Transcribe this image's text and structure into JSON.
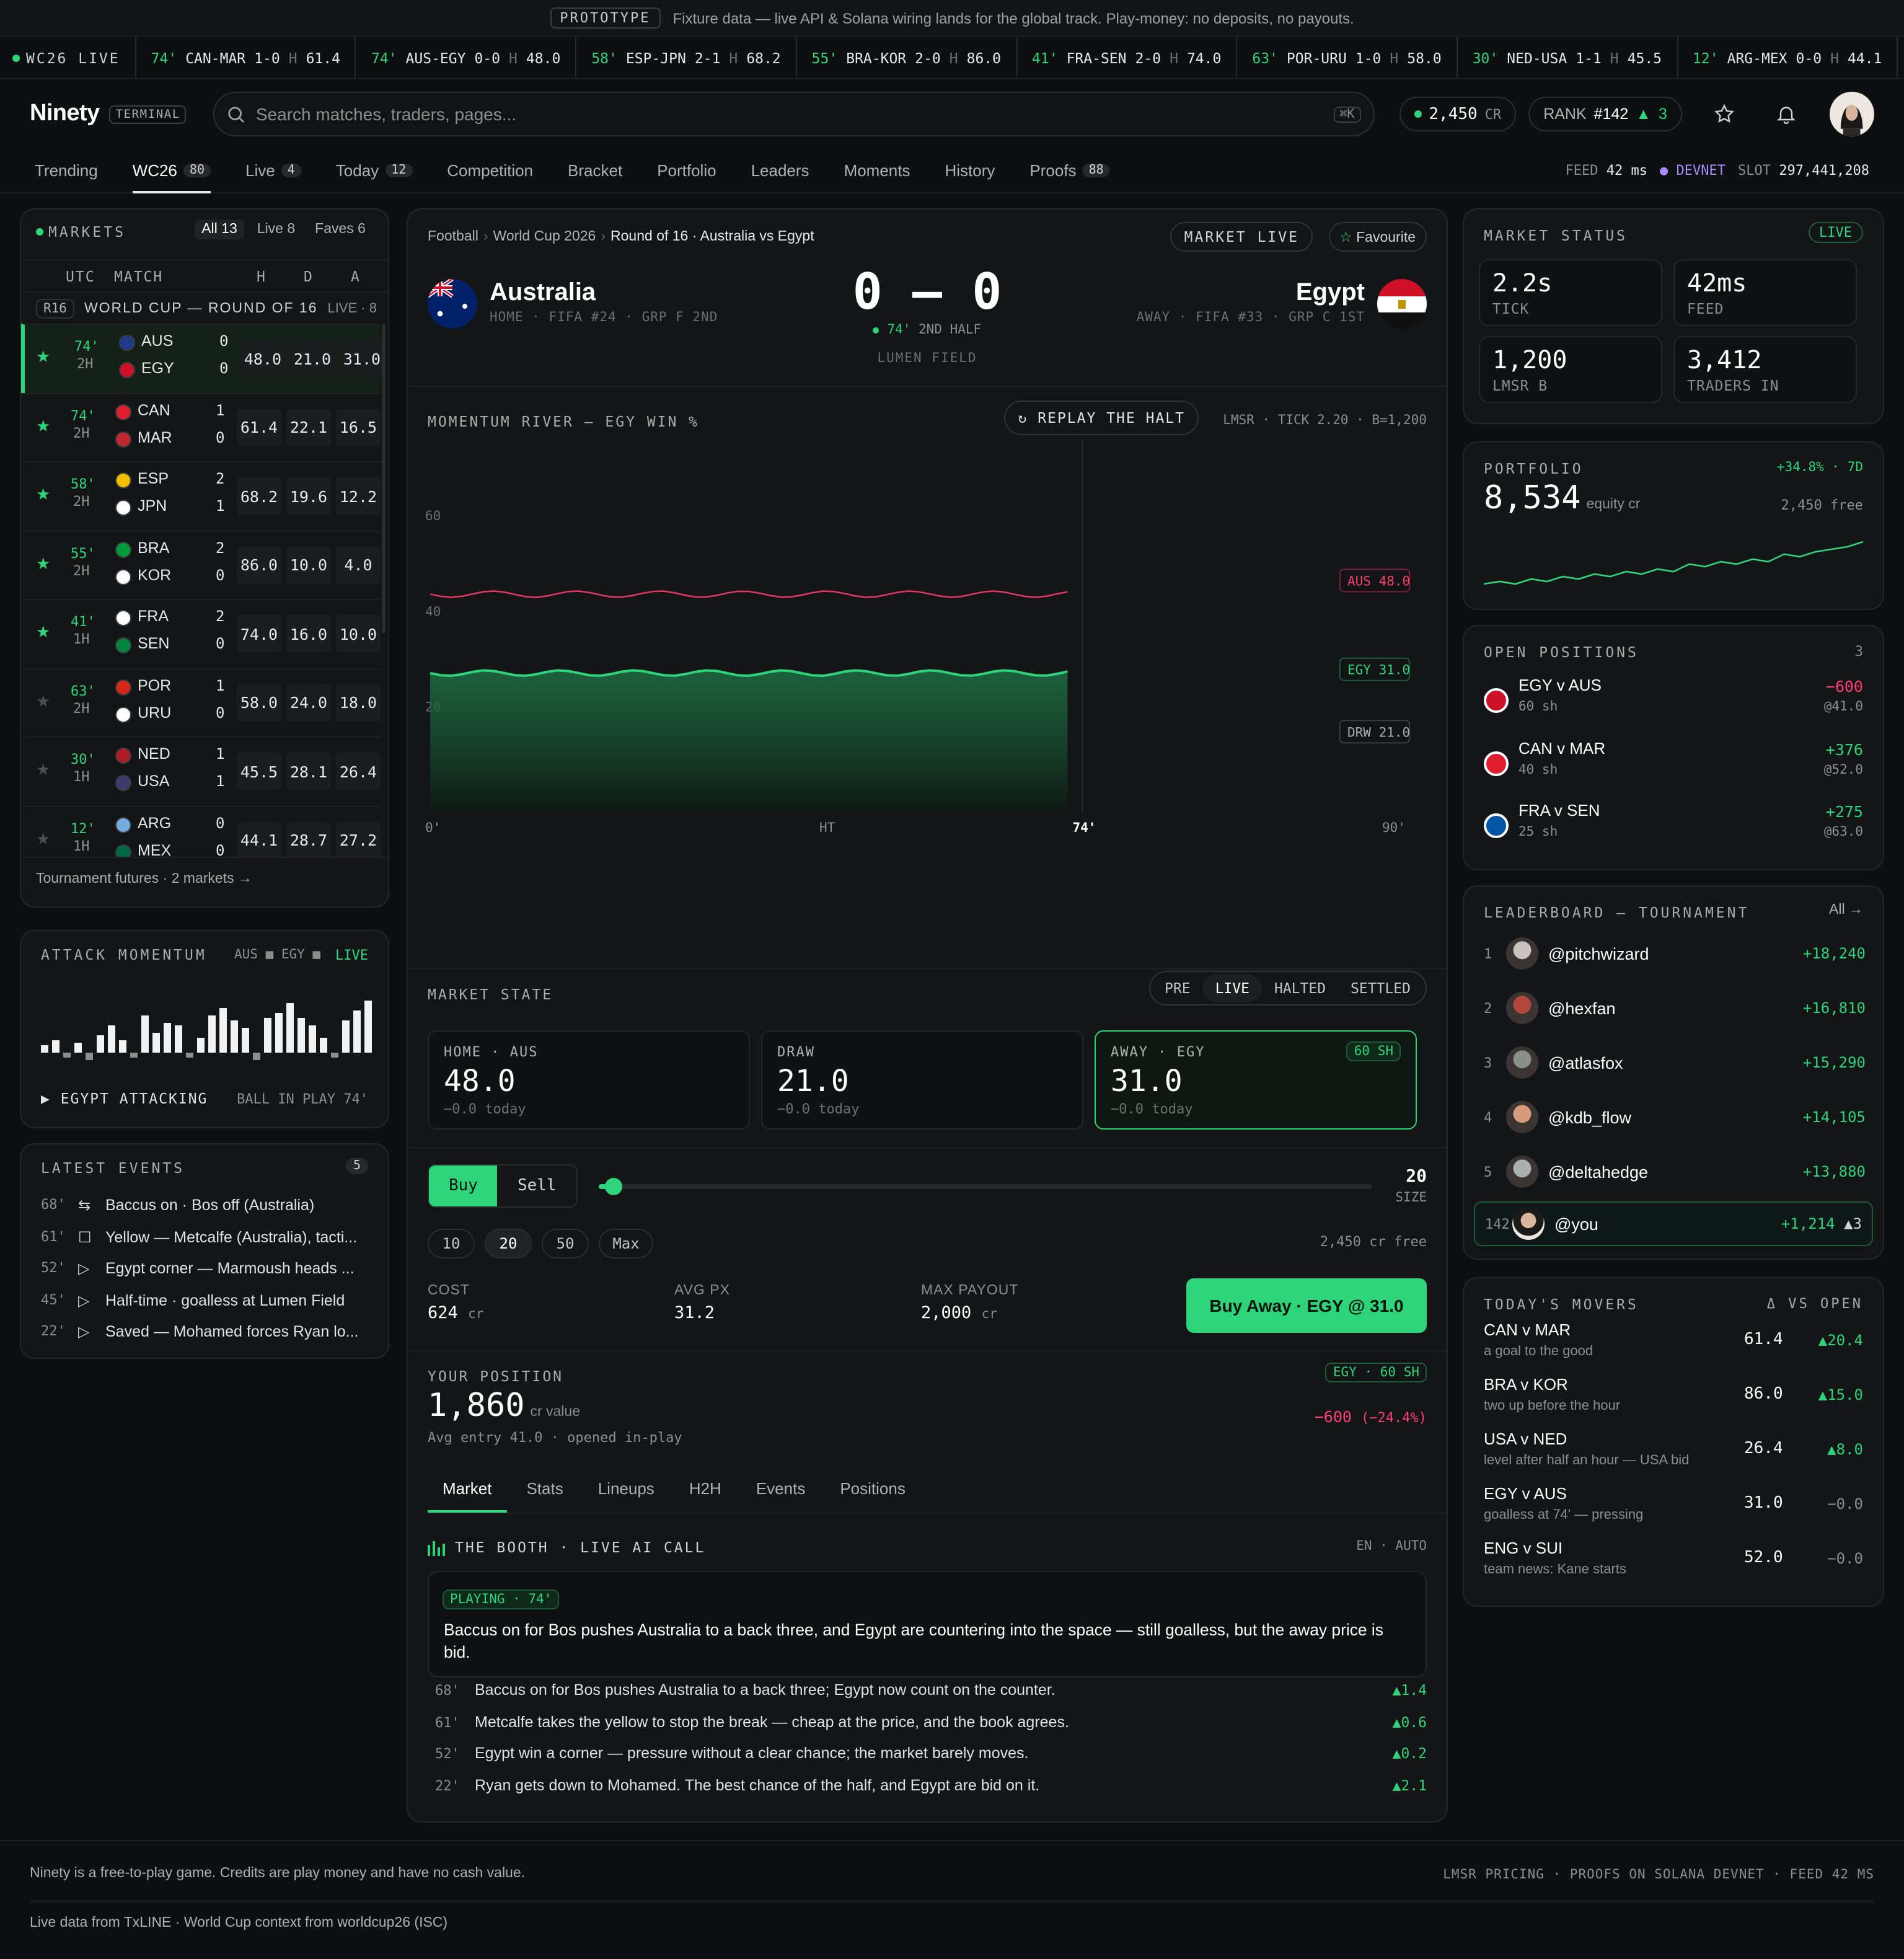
{
  "banner": {
    "tag": "PROTOTYPE",
    "text": "Fixture data — live API & Solana wiring lands for the global track. Play-money: no deposits, no payouts."
  },
  "ticker": {
    "label": "WC26 LIVE",
    "items": [
      {
        "min": "74'",
        "match": "CAN-MAR",
        "score": "1-0",
        "h": "H",
        "price": "61.4"
      },
      {
        "min": "74'",
        "match": "AUS-EGY",
        "score": "0-0",
        "h": "H",
        "price": "48.0"
      },
      {
        "min": "58'",
        "match": "ESP-JPN",
        "score": "2-1",
        "h": "H",
        "price": "68.2"
      },
      {
        "min": "55'",
        "match": "BRA-KOR",
        "score": "2-0",
        "h": "H",
        "price": "86.0"
      },
      {
        "min": "41'",
        "match": "FRA-SEN",
        "score": "2-0",
        "h": "H",
        "price": "74.0"
      },
      {
        "min": "63'",
        "match": "POR-URU",
        "score": "1-0",
        "h": "H",
        "price": "58.0"
      },
      {
        "min": "30'",
        "match": "NED-USA",
        "score": "1-1",
        "h": "H",
        "price": "45.5"
      },
      {
        "min": "12'",
        "match": "ARG-MEX",
        "score": "0-0",
        "h": "H",
        "price": "44.1"
      }
    ]
  },
  "header": {
    "logo": "Ninety",
    "terminal": "TERMINAL",
    "search_placeholder": "Search matches, traders, pages...",
    "kbd": "⌘K",
    "credits": "2,450",
    "credits_unit": "CR",
    "rank_label": "RANK",
    "rank": "#142",
    "rank_delta": "3"
  },
  "nav": {
    "tabs": [
      {
        "label": "Trending",
        "badge": ""
      },
      {
        "label": "WC26",
        "badge": "80"
      },
      {
        "label": "Live",
        "badge": "4"
      },
      {
        "label": "Today",
        "badge": "12"
      },
      {
        "label": "Competition",
        "badge": ""
      },
      {
        "label": "Bracket",
        "badge": ""
      },
      {
        "label": "Portfolio",
        "badge": ""
      },
      {
        "label": "Leaders",
        "badge": ""
      },
      {
        "label": "Moments",
        "badge": ""
      },
      {
        "label": "History",
        "badge": ""
      },
      {
        "label": "Proofs",
        "badge": "88"
      }
    ],
    "feed_label": "FEED",
    "feed": "42 ms",
    "devnet": "DEVNET",
    "slot_label": "SLOT",
    "slot": "297,441,208"
  },
  "markets": {
    "title": "MARKETS",
    "filters": [
      "All 13",
      "Live 8",
      "Faves 6"
    ],
    "cols": [
      "UTC",
      "MATCH",
      "H",
      "D",
      "A"
    ],
    "group": "R16",
    "group_title": "WORLD CUP — ROUND OF 16",
    "group_live": "LIVE · 8",
    "rows": [
      {
        "min": "74'",
        "half": "2H",
        "t1": "AUS",
        "t2": "EGY",
        "s1": "0",
        "s2": "0",
        "h": "48.0",
        "d": "21.0",
        "a": "31.0",
        "fav": true,
        "c1": "#1e3a8a",
        "c2": "#ce1126"
      },
      {
        "min": "74'",
        "half": "2H",
        "t1": "CAN",
        "t2": "MAR",
        "s1": "1",
        "s2": "0",
        "h": "61.4",
        "d": "22.1",
        "a": "16.5",
        "fav": true,
        "c1": "#e11d2e",
        "c2": "#c1272d"
      },
      {
        "min": "58'",
        "half": "2H",
        "t1": "ESP",
        "t2": "JPN",
        "s1": "2",
        "s2": "1",
        "h": "68.2",
        "d": "19.6",
        "a": "12.2",
        "fav": true,
        "c1": "#f1bf00",
        "c2": "#ffffff"
      },
      {
        "min": "55'",
        "half": "2H",
        "t1": "BRA",
        "t2": "KOR",
        "s1": "2",
        "s2": "0",
        "h": "86.0",
        "d": "10.0",
        "a": "4.0",
        "fav": true,
        "c1": "#009c3b",
        "c2": "#ffffff"
      },
      {
        "min": "41'",
        "half": "1H",
        "t1": "FRA",
        "t2": "SEN",
        "s1": "2",
        "s2": "0",
        "h": "74.0",
        "d": "16.0",
        "a": "10.0",
        "fav": true,
        "c1": "#ffffff",
        "c2": "#00853f"
      },
      {
        "min": "63'",
        "half": "2H",
        "t1": "POR",
        "t2": "URU",
        "s1": "1",
        "s2": "0",
        "h": "58.0",
        "d": "24.0",
        "a": "18.0",
        "fav": false,
        "c1": "#d62718",
        "c2": "#ffffff"
      },
      {
        "min": "30'",
        "half": "1H",
        "t1": "NED",
        "t2": "USA",
        "s1": "1",
        "s2": "1",
        "h": "45.5",
        "d": "28.1",
        "a": "26.4",
        "fav": false,
        "c1": "#ae1c28",
        "c2": "#3c3b6e"
      },
      {
        "min": "12'",
        "half": "1H",
        "t1": "ARG",
        "t2": "MEX",
        "s1": "0",
        "s2": "0",
        "h": "44.1",
        "d": "28.7",
        "a": "27.2",
        "fav": false,
        "c1": "#74acdf",
        "c2": "#006847"
      }
    ],
    "footer": "Tournament futures · 2 markets →"
  },
  "attack": {
    "title": "ATTACK MOMENTUM",
    "legend": "AUS ■ EGY ■",
    "live": "LIVE",
    "bars": [
      6,
      10,
      -4,
      8,
      -6,
      14,
      22,
      10,
      -4,
      30,
      16,
      24,
      22,
      -4,
      12,
      30,
      36,
      26,
      20,
      -6,
      28,
      32,
      40,
      28,
      22,
      12,
      -4,
      26,
      34,
      42
    ],
    "status": "▶ EGYPT ATTACKING",
    "ball": "BALL IN PLAY 74'"
  },
  "events": {
    "title": "LATEST EVENTS",
    "count": "5",
    "items": [
      {
        "min": "68'",
        "icon": "sub",
        "text": "Baccus on · Bos off (Australia)"
      },
      {
        "min": "61'",
        "icon": "card",
        "text": "Yellow — Metcalfe (Australia), tacti..."
      },
      {
        "min": "52'",
        "icon": "play",
        "text": "Egypt corner — Marmoush heads ..."
      },
      {
        "min": "45'",
        "icon": "play",
        "text": "Half-time · goalless at Lumen Field"
      },
      {
        "min": "22'",
        "icon": "play",
        "text": "Saved — Mohamed forces Ryan lo..."
      }
    ]
  },
  "match": {
    "breadcrumb": [
      "Football",
      "World Cup 2026",
      "Round of 16 · Australia vs Egypt"
    ],
    "market_live": "MARKET LIVE",
    "favourite": "Favourite",
    "home": "Australia",
    "home_meta": "HOME · FIFA #24 · GRP F 2ND",
    "away": "Egypt",
    "away_meta": "AWAY · FIFA #33 · GRP C 1ST",
    "score": "0 – 0",
    "min": "74'",
    "period": "2ND HALF",
    "venue": "LUMEN FIELD"
  },
  "chart_data": {
    "type": "line",
    "title": "MOMENTUM RIVER — EGY WIN %",
    "x": [
      "0'",
      "HT",
      "74'",
      "90'"
    ],
    "ylim": [
      0,
      70
    ],
    "yticks": [
      "60",
      "40",
      "20"
    ],
    "series": [
      {
        "name": "AUS",
        "label": "AUS 48.0",
        "color": "#ff3d71",
        "value": 48.0
      },
      {
        "name": "EGY",
        "label": "EGY 31.0",
        "color": "#2ed47a",
        "value": 31.0
      },
      {
        "name": "DRW",
        "label": "DRW 21.0",
        "color": "#a8ada9",
        "value": 21.0
      }
    ],
    "replay": "REPLAY THE HALT",
    "meta": "LMSR · TICK 2.20 · B=1,200"
  },
  "state": {
    "title": "MARKET STATE",
    "states": [
      "PRE",
      "LIVE",
      "HALTED",
      "SETTLED"
    ],
    "outcomes": [
      {
        "label": "HOME · AUS",
        "value": "48.0",
        "delta": "−0.0 today",
        "tag": ""
      },
      {
        "label": "DRAW",
        "value": "21.0",
        "delta": "−0.0 today",
        "tag": ""
      },
      {
        "label": "AWAY · EGY",
        "value": "31.0",
        "delta": "−0.0 today",
        "tag": "60 SH"
      }
    ]
  },
  "trade": {
    "buy": "Buy",
    "sell": "Sell",
    "size": "20",
    "size_label": "SIZE",
    "sizes": [
      "10",
      "20",
      "50",
      "Max"
    ],
    "free": "2,450 cr free",
    "size_fraction": 0.02,
    "cost_label": "COST",
    "cost": "624",
    "avg_label": "AVG PX",
    "avg": "31.2",
    "payout_label": "MAX PAYOUT",
    "payout": "2,000",
    "cr": "cr",
    "cta": "Buy Away · EGY @ 31.0"
  },
  "position": {
    "title": "YOUR POSITION",
    "tag": "EGY · 60 SH",
    "value": "1,860",
    "unit": "cr value",
    "meta": "Avg entry 41.0 · opened in-play",
    "pnl": "−600",
    "pnl_pct": "(−24.4%)"
  },
  "subtabs": [
    "Market",
    "Stats",
    "Lineups",
    "H2H",
    "Events",
    "Positions"
  ],
  "booth": {
    "title": "THE BOOTH · LIVE AI CALL",
    "lang": "EN · AUTO",
    "playing": "PLAYING · 74'",
    "call": "Baccus on for Bos pushes Australia to a back three, and Egypt are countering into the space — still goalless, but the away price is bid.",
    "lines": [
      {
        "min": "68'",
        "text": "Baccus on for Bos pushes Australia to a back three; Egypt now count on the counter.",
        "d": "1.4"
      },
      {
        "min": "61'",
        "text": "Metcalfe takes the yellow to stop the break — cheap at the price, and the book agrees.",
        "d": "0.6"
      },
      {
        "min": "52'",
        "text": "Egypt win a corner — pressure without a clear chance; the market barely moves.",
        "d": "0.2"
      },
      {
        "min": "22'",
        "text": "Ryan gets down to Mohamed. The best chance of the half, and Egypt are bid on it.",
        "d": "2.1"
      }
    ]
  },
  "status": {
    "title": "MARKET STATUS",
    "live": "LIVE",
    "boxes": [
      {
        "v": "2.2s",
        "l": "TICK"
      },
      {
        "v": "42ms",
        "l": "FEED"
      },
      {
        "v": "1,200",
        "l": "LMSR B"
      },
      {
        "v": "3,412",
        "l": "TRADERS IN"
      }
    ]
  },
  "portfolio": {
    "title": "PORTFOLIO",
    "change": "+34.8% · 7D",
    "value": "8,534",
    "unit": "equity cr",
    "free": "2,450 free",
    "spark": [
      3,
      4,
      3,
      5,
      4,
      6,
      5,
      7,
      6,
      8,
      7,
      9,
      8,
      11,
      10,
      12,
      11,
      13,
      12,
      15,
      14,
      16,
      17,
      18,
      20
    ]
  },
  "positions": {
    "title": "OPEN POSITIONS",
    "count": "3",
    "items": [
      {
        "name": "EGY v AUS",
        "sh": "60 sh",
        "pnl": "−600",
        "px": "@41.0",
        "neg": true,
        "c": "#ce1126"
      },
      {
        "name": "CAN v MAR",
        "sh": "40 sh",
        "pnl": "+376",
        "px": "@52.0",
        "neg": false,
        "c": "#e11d2e"
      },
      {
        "name": "FRA v SEN",
        "sh": "25 sh",
        "pnl": "+275",
        "px": "@63.0",
        "neg": false,
        "c": "#0055a4"
      }
    ]
  },
  "leaderboard": {
    "title": "LEADERBOARD — TOURNAMENT",
    "all": "All →",
    "items": [
      {
        "rank": "1",
        "name": "@pitchwizard",
        "score": "+18,240"
      },
      {
        "rank": "2",
        "name": "@hexfan",
        "score": "+16,810"
      },
      {
        "rank": "3",
        "name": "@atlasfox",
        "score": "+15,290"
      },
      {
        "rank": "4",
        "name": "@kdb_flow",
        "score": "+14,105"
      },
      {
        "rank": "5",
        "name": "@deltahedge",
        "score": "+13,880"
      }
    ],
    "you": {
      "rank": "142",
      "name": "@you",
      "score": "+1,214",
      "delta": "3"
    }
  },
  "movers": {
    "title": "TODAY'S MOVERS",
    "vs": "Δ VS OPEN",
    "items": [
      {
        "name": "CAN v MAR",
        "sub": "a goal to the good",
        "price": "61.4",
        "d": "20.4",
        "up": true
      },
      {
        "name": "BRA v KOR",
        "sub": "two up before the hour",
        "price": "86.0",
        "d": "15.0",
        "up": true
      },
      {
        "name": "USA v NED",
        "sub": "level after half an hour — USA bid",
        "price": "26.4",
        "d": "8.0",
        "up": true
      },
      {
        "name": "EGY v AUS",
        "sub": "goalless at 74' — pressing",
        "price": "31.0",
        "d": "−0.0",
        "up": false
      },
      {
        "name": "ENG v SUI",
        "sub": "team news: Kane starts",
        "price": "52.0",
        "d": "−0.0",
        "up": false
      }
    ]
  },
  "footer": {
    "left": "Ninety is a free-to-play game. Credits are play money and have no cash value.",
    "right": "LMSR PRICING · PROOFS ON SOLANA DEVNET · FEED 42 MS",
    "bottom": "Live data from TxLINE · World Cup context from worldcup26 (ISC)"
  }
}
